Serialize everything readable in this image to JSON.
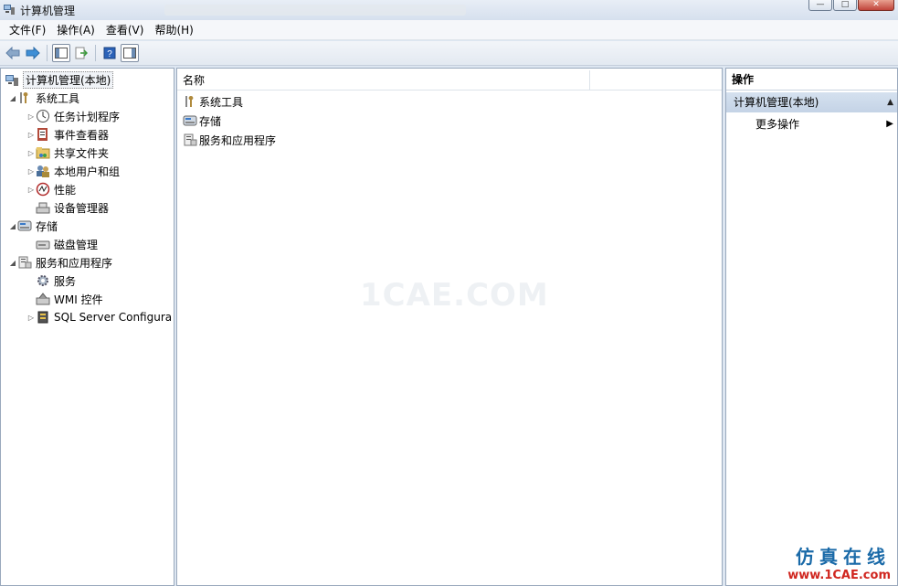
{
  "window": {
    "title": "计算机管理",
    "buttons": {
      "minimize": "—",
      "maximize": "□",
      "close": "✕"
    }
  },
  "menu": [
    "文件(F)",
    "操作(A)",
    "查看(V)",
    "帮助(H)"
  ],
  "tree": {
    "root": "计算机管理(本地)",
    "items": [
      {
        "label": "系统工具",
        "level": 1,
        "expanded": true,
        "icon": "tools-icon"
      },
      {
        "label": "任务计划程序",
        "level": 2,
        "expander": true,
        "icon": "clock-icon"
      },
      {
        "label": "事件查看器",
        "level": 2,
        "expander": true,
        "icon": "event-viewer-icon"
      },
      {
        "label": "共享文件夹",
        "level": 2,
        "expander": true,
        "icon": "shared-folder-icon"
      },
      {
        "label": "本地用户和组",
        "level": 2,
        "expander": true,
        "icon": "users-icon"
      },
      {
        "label": "性能",
        "level": 2,
        "expander": true,
        "icon": "performance-icon"
      },
      {
        "label": "设备管理器",
        "level": 2,
        "expander": false,
        "icon": "device-manager-icon"
      },
      {
        "label": "存储",
        "level": 1,
        "expanded": true,
        "icon": "storage-icon"
      },
      {
        "label": "磁盘管理",
        "level": 2,
        "expander": false,
        "icon": "disk-icon"
      },
      {
        "label": "服务和应用程序",
        "level": 1,
        "expanded": true,
        "icon": "services-apps-icon"
      },
      {
        "label": "服务",
        "level": 2,
        "expander": false,
        "icon": "gear-icon"
      },
      {
        "label": "WMI 控件",
        "level": 2,
        "expander": false,
        "icon": "wmi-icon"
      },
      {
        "label": "SQL Server Configura",
        "level": 2,
        "expander": true,
        "icon": "sql-server-icon"
      }
    ]
  },
  "list": {
    "columns": [
      "名称"
    ],
    "rows": [
      {
        "label": "系统工具",
        "icon": "tools-icon"
      },
      {
        "label": "存储",
        "icon": "storage-icon"
      },
      {
        "label": "服务和应用程序",
        "icon": "services-apps-icon"
      }
    ]
  },
  "watermark": "1CAE.COM",
  "actions": {
    "header": "操作",
    "section": "计算机管理(本地)",
    "item": "更多操作"
  },
  "footer": {
    "cn": "仿真在线",
    "url": "www.1CAE.com"
  },
  "colors": {
    "accent": "#1a6aa8",
    "footer_red": "#d0261f",
    "section_bg": "#c4d3e6"
  }
}
